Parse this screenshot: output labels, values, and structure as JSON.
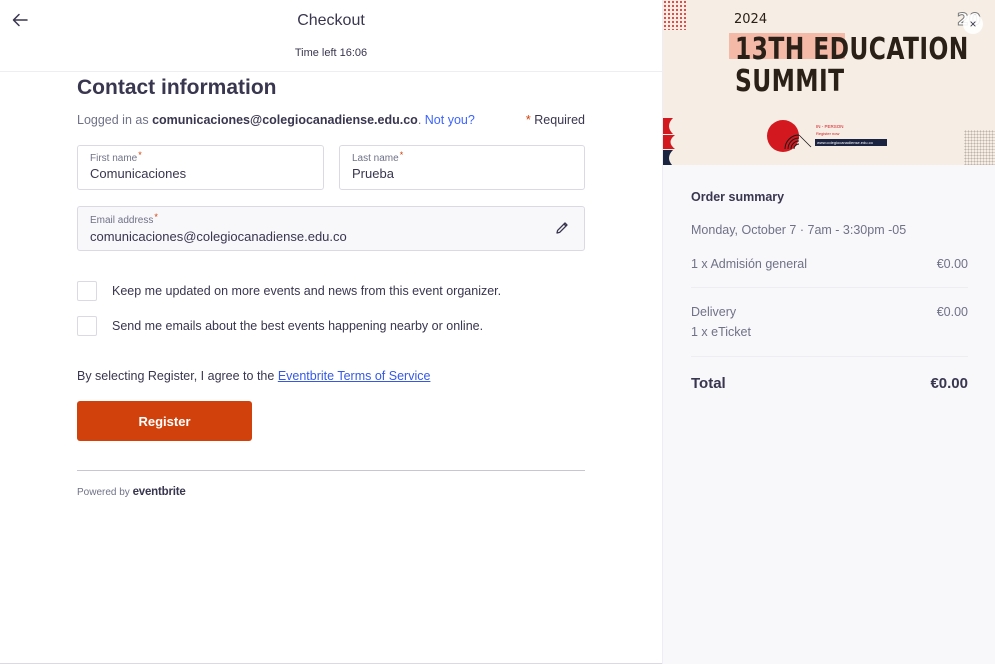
{
  "header": {
    "back_icon": "arrow-left-icon",
    "title": "Checkout",
    "time_left": "Time left 16:06"
  },
  "contact": {
    "title": "Contact information",
    "logged_prefix": "Logged in as ",
    "logged_email": "comunicaciones@colegiocanadiense.edu.co",
    "logged_suffix": ". ",
    "not_you": "Not you?",
    "required_star": "*",
    "required": " Required",
    "first_name_label": "First name",
    "first_name_value": "Comunicaciones",
    "last_name_label": "Last name",
    "last_name_value": "Prueba",
    "email_label": "Email address",
    "email_value": "comunicaciones@colegiocanadiense.edu.co",
    "star": "*",
    "edit_icon": "pencil-icon"
  },
  "checkboxes": [
    {
      "label": "Keep me updated on more events and news from this event organizer.",
      "checked": false
    },
    {
      "label": "Send me emails about the best events happening nearby or online.",
      "checked": false
    }
  ],
  "terms": {
    "prefix": "By selecting Register, I agree to the ",
    "link": "Eventbrite Terms of Service"
  },
  "register_label": "Register",
  "footer": {
    "powered_by": "Powered by ",
    "brand": "eventbrite"
  },
  "banner": {
    "year": "2024",
    "title_line1": "13TH EDUCATION",
    "title_line2": "SUMMIT",
    "in_person": "IN - PERSON",
    "register_now": "Register now",
    "url": "www.colegiocanadiense.edu.co",
    "logo_text": "20"
  },
  "close_label": "×",
  "order_summary": {
    "title": "Order summary",
    "date": "Monday, October 7 · 7am - 3:30pm -05",
    "items": [
      {
        "label": "1 x Admisión general",
        "price": "€0.00"
      }
    ],
    "delivery_label": "Delivery",
    "delivery_price": "€0.00",
    "delivery_detail": "1 x eTicket",
    "total_label": "Total",
    "total_price": "€0.00"
  },
  "colors": {
    "accent": "#d1410c",
    "link": "#3d64ff",
    "text": "#39364f",
    "muted": "#6f7287",
    "panel": "#f8f7fa"
  }
}
